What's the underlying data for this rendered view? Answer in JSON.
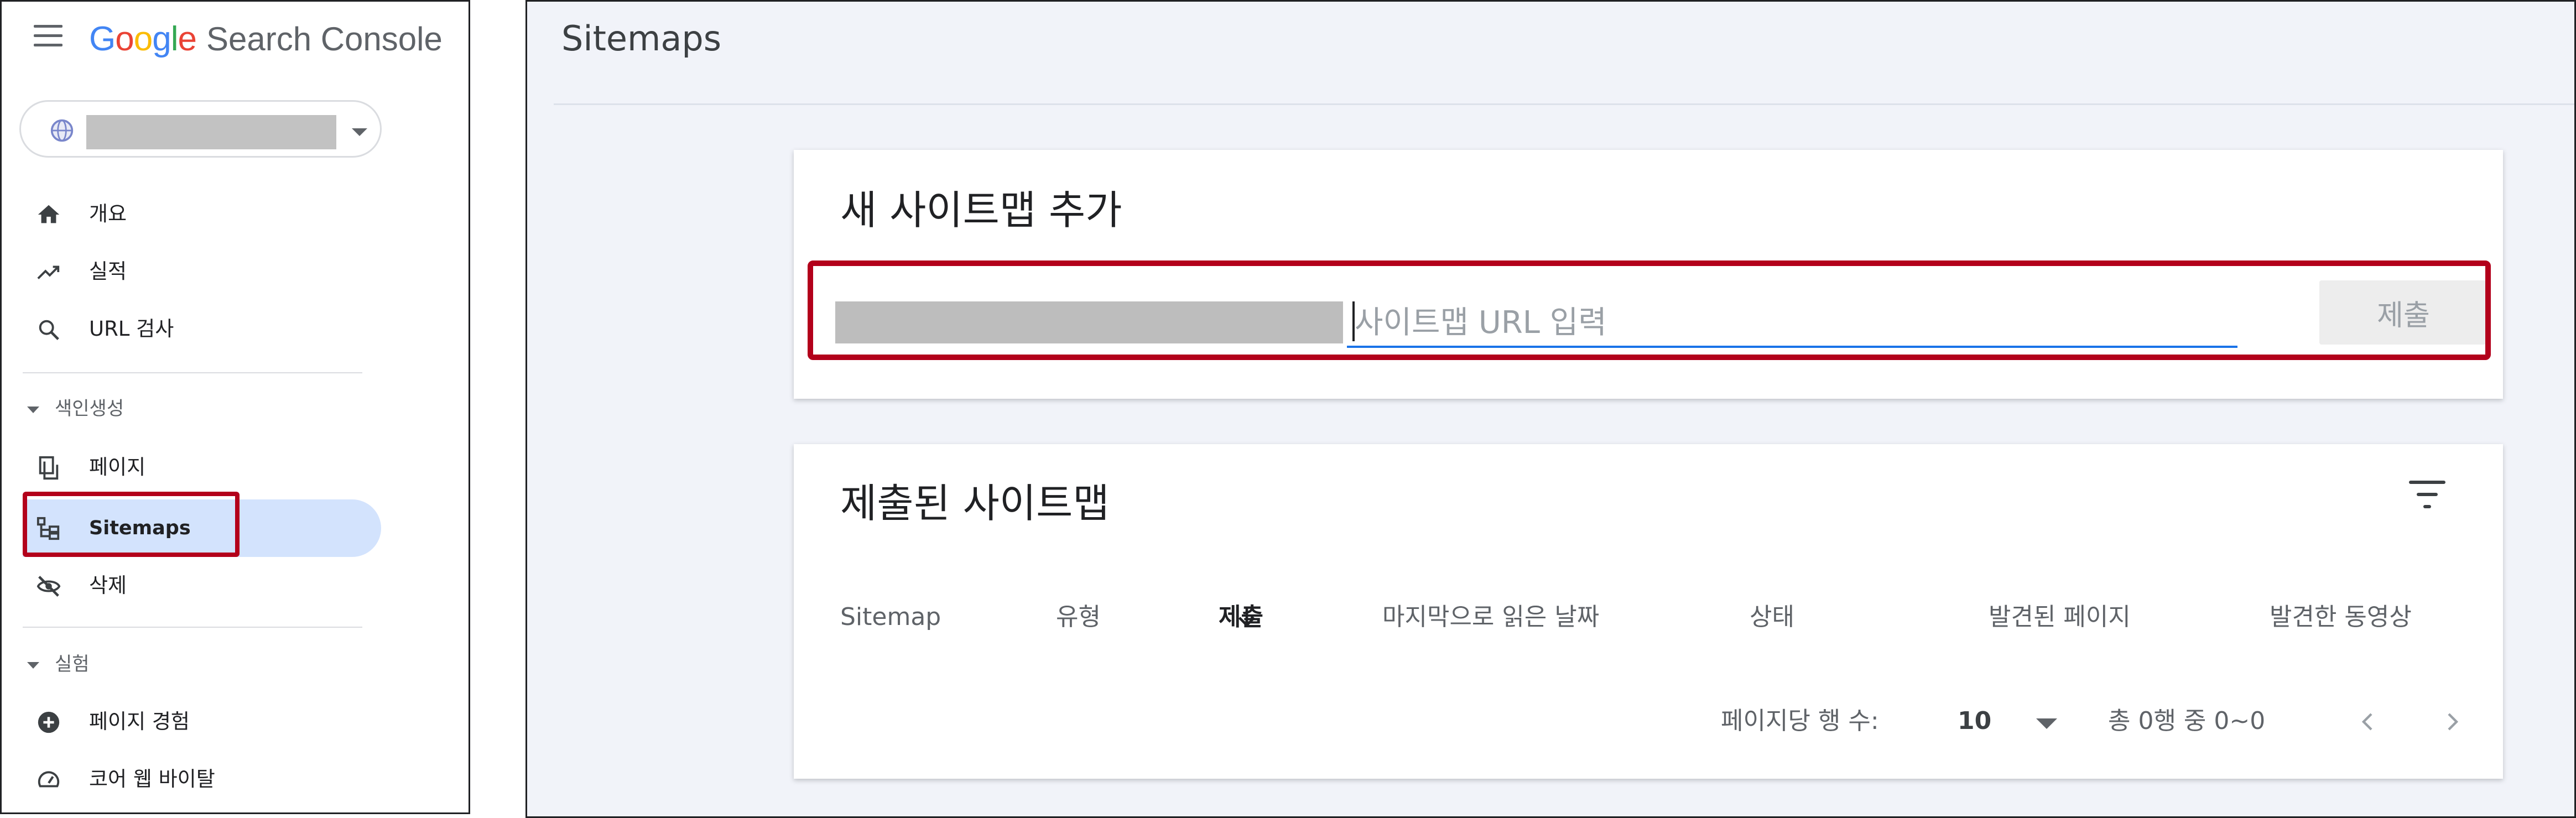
{
  "app": {
    "logo_letters": [
      {
        "ch": "G",
        "color": "#4285F4"
      },
      {
        "ch": "o",
        "color": "#EA4335"
      },
      {
        "ch": "o",
        "color": "#FBBC05"
      },
      {
        "ch": "g",
        "color": "#4285F4"
      },
      {
        "ch": "l",
        "color": "#34A853"
      },
      {
        "ch": "e",
        "color": "#EA4335"
      }
    ],
    "product_name": "Search Console",
    "menu_icon": "hamburger-menu-icon"
  },
  "property_selector": {
    "icon": "globe-icon",
    "value_redacted": true,
    "dropdown_icon": "caret-down-icon"
  },
  "sidebar": {
    "items": [
      {
        "label": "개요",
        "icon": "home-icon"
      },
      {
        "label": "실적",
        "icon": "trending-up-icon"
      },
      {
        "label": "URL 검사",
        "icon": "search-icon"
      }
    ],
    "section_indexing": {
      "title": "색인생성",
      "items": [
        {
          "label": "페이지",
          "icon": "pages-icon"
        },
        {
          "label": "Sitemaps",
          "icon": "sitemap-icon",
          "selected": true
        },
        {
          "label": "삭제",
          "icon": "visibility-off-icon"
        }
      ]
    },
    "section_experience": {
      "title": "실험",
      "items": [
        {
          "label": "페이지 경험",
          "icon": "add-circle-icon"
        },
        {
          "label": "코어 웹 바이탈",
          "icon": "speed-gauge-icon"
        }
      ]
    }
  },
  "main": {
    "title": "Sitemaps",
    "add_card": {
      "title": "새 사이트맵 추가",
      "url_input_placeholder": "사이트맵 URL 입력",
      "url_input_value": "",
      "submit_label": "제출"
    },
    "list_card": {
      "title": "제출된 사이트맵",
      "filter_icon": "filter-list-icon",
      "columns": [
        "Sitemap",
        "유형",
        "제출",
        "마지막으로 읽은 날짜",
        "상태",
        "발견된 페이지",
        "발견한 동영상"
      ],
      "sort_icon": "arrow-downward-icon",
      "rows": [],
      "pagination": {
        "rows_per_page_label": "페이지당 행 수:",
        "rows_per_page_value": "10",
        "range_text": "총 0행 중 0~0",
        "prev_icon": "chevron-left-icon",
        "next_icon": "chevron-right-icon"
      }
    }
  },
  "colors": {
    "accent_blue": "#1a73e8",
    "selected_nav_bg": "#d3e3fd",
    "highlight_red": "#b3001b",
    "main_bg": "#f1f3f9"
  }
}
